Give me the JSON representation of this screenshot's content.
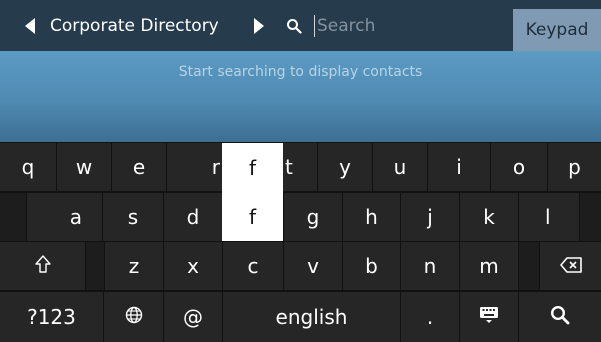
{
  "header": {
    "title": "Corporate Directory",
    "search_placeholder": "Search",
    "keypad_label": "Keypad"
  },
  "contacts": {
    "hint": "Start searching to display contacts"
  },
  "keyboard": {
    "row1": [
      "q",
      "w",
      "e",
      "r",
      "f",
      "t",
      "y",
      "u",
      "i",
      "o",
      "p"
    ],
    "row2": [
      "a",
      "s",
      "d",
      "f",
      "g",
      "h",
      "j",
      "k",
      "l"
    ],
    "row3": [
      "z",
      "x",
      "c",
      "v",
      "b",
      "n",
      "m"
    ],
    "row4": {
      "numbers_label": "?123",
      "at_label": "@",
      "space_label": "english",
      "period_label": "."
    }
  },
  "colors": {
    "header": "#263b4c",
    "keypad_button": "#7f9ab2",
    "panel": "#4f8ab2",
    "key": "#262626",
    "keyboard_bg": "#111111"
  }
}
